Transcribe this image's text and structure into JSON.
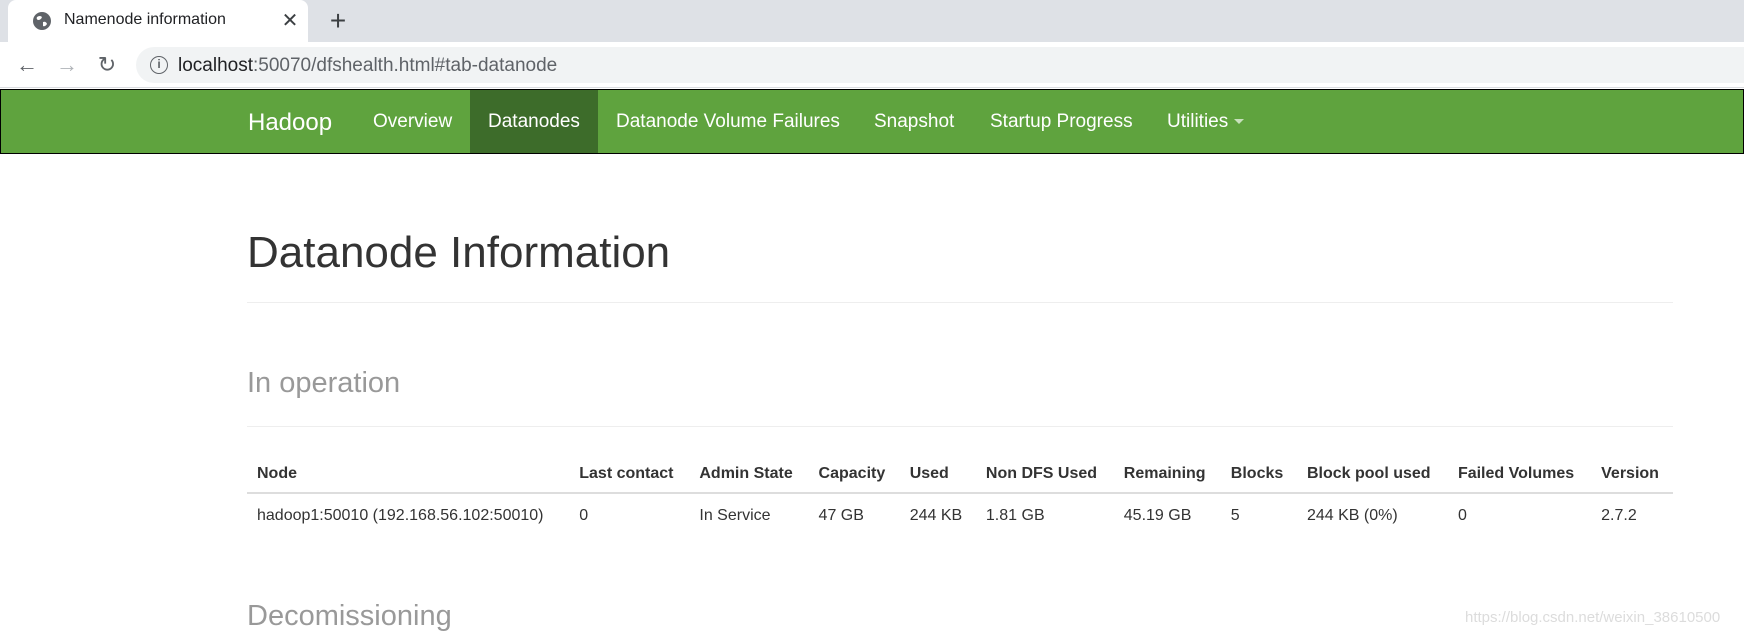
{
  "browser": {
    "tab": {
      "title": "Namenode information",
      "icon": "globe-icon",
      "close": "✕"
    },
    "new_tab": "+",
    "url_host": "localhost",
    "url_rest": ":50070/dfshealth.html#tab-datanode"
  },
  "navbar": {
    "brand": "Hadoop",
    "items": [
      {
        "label": "Overview"
      },
      {
        "label": "Datanodes",
        "active": true
      },
      {
        "label": "Datanode Volume Failures"
      },
      {
        "label": "Snapshot"
      },
      {
        "label": "Startup Progress"
      },
      {
        "label": "Utilities",
        "dropdown": true
      }
    ],
    "colors": {
      "bar": "#5fa33e",
      "active": "#3d6c2a"
    }
  },
  "page": {
    "title": "Datanode Information",
    "sections": {
      "in_operation": "In operation",
      "decomissioning": "Decomissioning"
    }
  },
  "table": {
    "headers": [
      "Node",
      "Last contact",
      "Admin State",
      "Capacity",
      "Used",
      "Non DFS Used",
      "Remaining",
      "Blocks",
      "Block pool used",
      "Failed Volumes",
      "Version"
    ],
    "rows": [
      [
        "hadoop1:50010 (192.168.56.102:50010)",
        "0",
        "In Service",
        "47 GB",
        "244 KB",
        "1.81 GB",
        "45.19 GB",
        "5",
        "244 KB (0%)",
        "0",
        "2.7.2"
      ]
    ]
  },
  "watermark": "https://blog.csdn.net/weixin_38610500"
}
